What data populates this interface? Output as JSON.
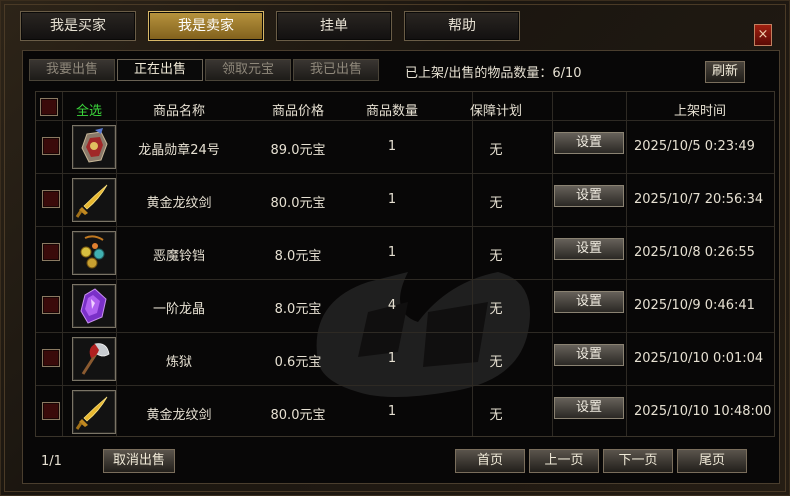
{
  "top_tabs": [
    "我是买家",
    "我是卖家",
    "挂单",
    "帮助"
  ],
  "active_top_tab": 1,
  "close_label": "×",
  "sub_tabs": [
    "我要出售",
    "正在出售",
    "领取元宝",
    "我已出售"
  ],
  "active_sub_tab": 1,
  "item_count_label": "已上架/出售的物品数量：6/10",
  "refresh_label": "刷新",
  "table": {
    "select_all": "全选",
    "columns": [
      "商品名称",
      "商品价格",
      "商品数量",
      "保障计划",
      "",
      "上架时间"
    ],
    "set_label": "设置",
    "rows": [
      {
        "icon": "medal-icon",
        "name": "龙晶勋章24号",
        "price": "89.0元宝",
        "qty": "1",
        "guarantee": "无",
        "time": "2025/10/5 0:23:49"
      },
      {
        "icon": "golden-sword-icon",
        "name": "黄金龙纹剑",
        "price": "80.0元宝",
        "qty": "1",
        "guarantee": "无",
        "time": "2025/10/7 20:56:34"
      },
      {
        "icon": "bell-icon",
        "name": "恶魔铃铛",
        "price": "8.0元宝",
        "qty": "1",
        "guarantee": "无",
        "time": "2025/10/8 0:26:55"
      },
      {
        "icon": "purple-crystal-icon",
        "name": "一阶龙晶",
        "price": "8.0元宝",
        "qty": "4",
        "guarantee": "无",
        "time": "2025/10/9 0:46:41"
      },
      {
        "icon": "axe-icon",
        "name": "炼狱",
        "price": "0.6元宝",
        "qty": "1",
        "guarantee": "无",
        "time": "2025/10/10 0:01:04"
      },
      {
        "icon": "golden-sword-icon",
        "name": "黄金龙纹剑",
        "price": "80.0元宝",
        "qty": "1",
        "guarantee": "无",
        "time": "2025/10/10 10:48:00"
      }
    ]
  },
  "pagination": {
    "info": "1/1",
    "cancel_sale": "取消出售",
    "first": "首页",
    "prev": "上一页",
    "next": "下一页",
    "last": "尾页"
  },
  "colors": {
    "active_tab": "#b8943e",
    "select_all_text": "#3cd83c",
    "checkbox": "#3a0a0a",
    "close": "#a02010"
  }
}
